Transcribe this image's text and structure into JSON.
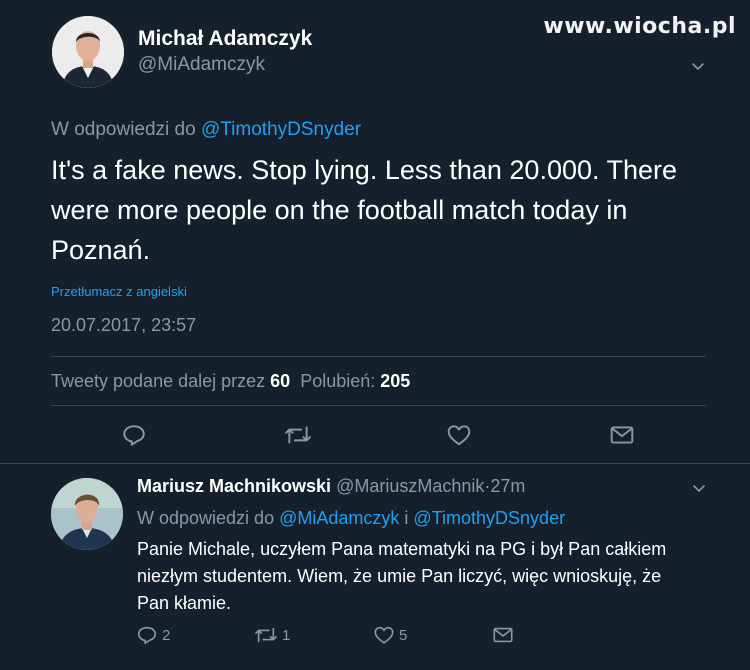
{
  "watermark": "www.wiocha.pl",
  "main_tweet": {
    "author_name": "Michał Adamczyk",
    "author_handle": "@MiAdamczyk",
    "reply_prefix": "W odpowiedzi do",
    "reply_mention": "@TimothyDSnyder",
    "text": "It's a fake news. Stop lying. Less than 20.000. There were more people on the football match today in Poznań.",
    "translate_label": "Przetłumacz z angielski",
    "timestamp": "20.07.2017, 23:57",
    "retweets_label": "Tweety podane dalej przez",
    "retweets_count": "60",
    "likes_label": "Polubień:",
    "likes_count": "205",
    "icons": [
      "reply-icon",
      "retweet-icon",
      "like-icon",
      "message-icon"
    ]
  },
  "reply_tweet": {
    "author_name": "Mariusz Machnikowski",
    "author_handle": "@MariuszMachnik",
    "separator": "·",
    "time": "27m",
    "reply_prefix": "W odpowiedzi do",
    "reply_mention_1": "@MiAdamczyk",
    "reply_joiner": "i",
    "reply_mention_2": "@TimothyDSnyder",
    "text": "Panie Michale, uczyłem Pana matematyki na PG i był Pan całkiem niezłym studentem. Wiem, że umie Pan liczyć, więc wnioskuję, że Pan kłamie.",
    "replies_count": "2",
    "retweets_count": "1",
    "likes_count": "5"
  },
  "colors": {
    "background": "#16202c",
    "text_primary": "#ffffff",
    "text_secondary": "#8899a6",
    "link": "#1da1f2",
    "divider": "#38444d"
  }
}
